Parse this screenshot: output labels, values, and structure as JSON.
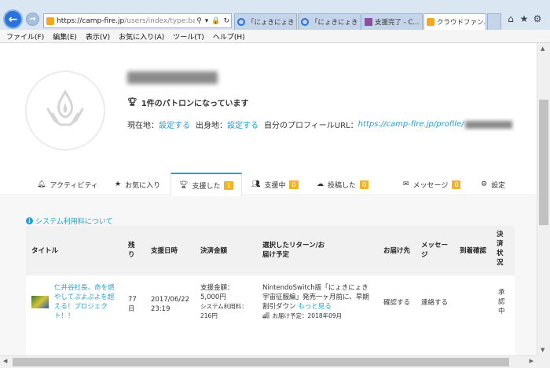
{
  "browser": {
    "url_host": "https://camp-fire.jp",
    "url_path": "/users/index/type:bacl",
    "tabs": [
      {
        "label": "「にょきにょき 宇..."
      },
      {
        "label": "「にょきにょき 宇..."
      },
      {
        "label": "支援完了 - C..."
      },
      {
        "label": "クラウドファン..."
      }
    ],
    "menu": [
      "ファイル(F)",
      "編集(E)",
      "表示(V)",
      "お気に入り(A)",
      "ツール(T)",
      "ヘルプ(H)"
    ],
    "colors": {
      "chrome": "#dbe6f3",
      "accent": "#1ea0d2",
      "badge": "#f5b323"
    }
  },
  "profile": {
    "patron_text": "1件のパトロンになっています",
    "current_location_label": "現在地：",
    "current_location_link": "設定する",
    "hometown_label": "出身地：",
    "hometown_link": "設定する",
    "profile_url_label": "自分のプロフィールURL：",
    "profile_url": "https://camp-fire.jp/profile/"
  },
  "tabs": [
    {
      "label": "アクティビティ",
      "icon": "bell-icon"
    },
    {
      "label": "お気に入り",
      "icon": "star-icon"
    },
    {
      "label": "支援した",
      "icon": "trophy-icon",
      "badge": "1",
      "active": true
    },
    {
      "label": "支援中",
      "icon": "users-icon",
      "badge": "0"
    },
    {
      "label": "投稿した",
      "icon": "cloud-upload-icon",
      "badge": "0"
    },
    {
      "label": "メッセージ",
      "icon": "envelope-icon",
      "badge": "0"
    },
    {
      "label": "設定",
      "icon": "gear-icon"
    }
  ],
  "system_fee_link": "システム利用料について",
  "table": {
    "headers": {
      "title": "タイトル",
      "remaining": "残り",
      "date": "支援日時",
      "amount": "決済金額",
      "reward": "選択したリターン/お届け予定",
      "delivery": "お届け先",
      "message": "メッセージ",
      "arrival": "到着確認",
      "payment": "決済状況"
    },
    "rows": [
      {
        "title": "仁井谷社長、命を燃やしてぷよぷよを超える！プロジェクト！！",
        "remaining": "77日",
        "date": "2017/06/22 23:19",
        "amount_label": "支援金額：",
        "amount": "5,000円",
        "fee_label": "システム利用料：",
        "fee": "216円",
        "reward": "NintendoSwitch版「にょきにょき 宇宙征服編」発売一ヶ月前に、早期割引ダウン",
        "more": "もっと見る",
        "delivery_schedule": "お届け予定：2018年09月",
        "delivery_action": "確認する",
        "message_action": "連絡する",
        "payment_status": "承認中"
      }
    ]
  }
}
